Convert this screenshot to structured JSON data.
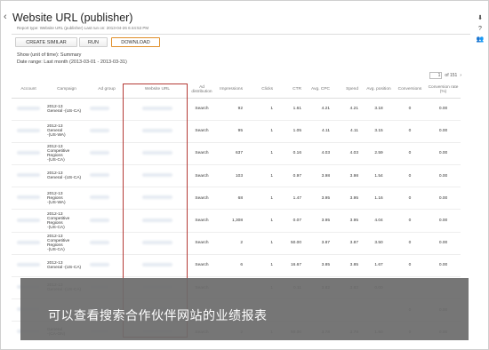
{
  "header": {
    "back_icon": "chevron-left-icon",
    "title": "Website URL (publisher)",
    "subtitle": "Report type: Website URL (publisher)   Last run on: 2013-04-26 6:44:53 PM"
  },
  "side_icons": [
    "download-icon",
    "help-icon",
    "users-icon"
  ],
  "toolbar": {
    "create_similar": "CREATE SIMILAR",
    "run": "RUN",
    "download": "DOWNLOAD"
  },
  "meta": {
    "show": "Show (unit of time): Summary",
    "date_range": "Date range: Last month (2013-03-01 - 2013-03-31)"
  },
  "pager": {
    "page": "1",
    "of_label": "of 151"
  },
  "table": {
    "headers": [
      "Account",
      "Campaign",
      "Ad group",
      "Website URL",
      "Ad distribution",
      "Impressions",
      "Clicks",
      "CTR",
      "Avg. CPC",
      "Spend",
      "Avg. position",
      "Conversions",
      "Conversion rate (%)"
    ],
    "rows": [
      {
        "campaign": "2012-13\nGeneral -(US-CA)",
        "distribution": "Search",
        "impressions": "92",
        "clicks": "1",
        "ctr": "1.61",
        "cpc": "4.21",
        "spend": "4.21",
        "position": "3.18",
        "conversions": "0",
        "conv_rate": "0.00"
      },
      {
        "campaign": "2012-13\nGeneral\n-(US-WA)",
        "distribution": "Search",
        "impressions": "95",
        "clicks": "1",
        "ctr": "1.05",
        "cpc": "4.11",
        "spend": "4.11",
        "position": "3.15",
        "conversions": "0",
        "conv_rate": "0.00"
      },
      {
        "campaign": "2012-13\nCompetitive\nRegions\n-(US-CA)",
        "distribution": "Search",
        "impressions": "637",
        "clicks": "1",
        "ctr": "0.16",
        "cpc": "4.03",
        "spend": "4.03",
        "position": "2.59",
        "conversions": "0",
        "conv_rate": "0.00"
      },
      {
        "campaign": "2012-13\nGeneral -(US-CA)",
        "distribution": "Search",
        "impressions": "103",
        "clicks": "1",
        "ctr": "0.97",
        "cpc": "3.98",
        "spend": "3.98",
        "position": "1.54",
        "conversions": "0",
        "conv_rate": "0.00"
      },
      {
        "campaign": "2012-13\nRegions\n-(US-WA)",
        "distribution": "Search",
        "impressions": "68",
        "clicks": "1",
        "ctr": "1.47",
        "cpc": "3.95",
        "spend": "3.95",
        "position": "1.16",
        "conversions": "0",
        "conv_rate": "0.00"
      },
      {
        "campaign": "2012-13\nCompetitive\nRegions\n-(US-CA)",
        "distribution": "Search",
        "impressions": "1,308",
        "clicks": "1",
        "ctr": "0.07",
        "cpc": "3.95",
        "spend": "3.95",
        "position": "4.04",
        "conversions": "0",
        "conv_rate": "0.00"
      },
      {
        "campaign": "2012-13\nCompetitive\nRegions\n-(US-CA)",
        "distribution": "Search",
        "impressions": "2",
        "clicks": "1",
        "ctr": "50.00",
        "cpc": "3.87",
        "spend": "3.87",
        "position": "3.50",
        "conversions": "0",
        "conv_rate": "0.00"
      },
      {
        "campaign": "2012-13\nGeneral -(US-CA)",
        "distribution": "Search",
        "impressions": "6",
        "clicks": "1",
        "ctr": "16.67",
        "cpc": "3.85",
        "spend": "3.85",
        "position": "1.67",
        "conversions": "0",
        "conv_rate": "0.00"
      },
      {
        "campaign": "2012-13\nGeneral -(US-CA)",
        "distribution": "Search",
        "impressions": "",
        "clicks": "1",
        "ctr": "0.11",
        "cpc": "3.82",
        "spend": "3.82",
        "position": "0.00",
        "conversions": "",
        "conv_rate": ""
      },
      {
        "campaign": "",
        "distribution": "",
        "impressions": "",
        "clicks": "",
        "ctr": "",
        "cpc": "",
        "spend": "",
        "position": "",
        "conversions": "0",
        "conv_rate": "0.00"
      },
      {
        "campaign": "General\n-(CA-ON)",
        "distribution": "Search",
        "impressions": "2",
        "clicks": "1",
        "ctr": "50.00",
        "cpc": "3.78",
        "spend": "3.78",
        "position": "1.50",
        "conversions": "0",
        "conv_rate": "0.00"
      }
    ]
  },
  "caption": "可以查看搜索合作伙伴网站的业绩报表",
  "colors": {
    "highlight": "#b53a36",
    "download_border": "#e08f2a",
    "overlay": "#6c6c6c"
  }
}
